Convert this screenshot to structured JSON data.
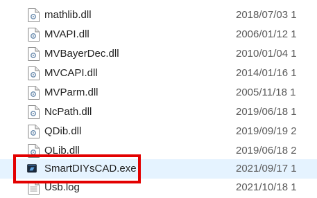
{
  "files": [
    {
      "name": "mathlib.dll",
      "date": "2018/07/03 1",
      "icon": "dll-file-icon"
    },
    {
      "name": "MVAPI.dll",
      "date": "2006/01/12 1",
      "icon": "dll-file-icon"
    },
    {
      "name": "MVBayerDec.dll",
      "date": "2010/01/04 1",
      "icon": "dll-file-icon"
    },
    {
      "name": "MVCAPI.dll",
      "date": "2014/01/16 1",
      "icon": "dll-file-icon"
    },
    {
      "name": "MVParm.dll",
      "date": "2005/11/18 1",
      "icon": "dll-file-icon"
    },
    {
      "name": "NcPath.dll",
      "date": "2019/06/18 1",
      "icon": "dll-file-icon"
    },
    {
      "name": "QDib.dll",
      "date": "2019/09/19 2",
      "icon": "dll-file-icon"
    },
    {
      "name": "QLib.dll",
      "date": "2019/06/18 2",
      "icon": "dll-file-icon"
    },
    {
      "name": "SmartDIYsCAD.exe",
      "date": "2021/09/17 1",
      "icon": "exe-app-icon"
    },
    {
      "name": "Usb.log",
      "date": "2021/10/18 1",
      "icon": "log-file-icon"
    }
  ],
  "colors": {
    "highlight_border": "#e30000",
    "selected_row": "#e5f3ff"
  }
}
